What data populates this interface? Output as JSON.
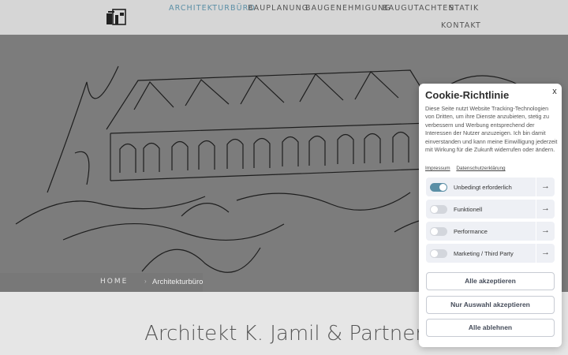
{
  "header": {
    "nav": [
      {
        "label": "ARCHITEKTURBÜRO",
        "active": true
      },
      {
        "label": "BAUPLANUNG",
        "active": false
      },
      {
        "label": "BAUGENEHMIGUNG",
        "active": false
      },
      {
        "label": "BAUGUTACHTEN",
        "active": false
      },
      {
        "label": "STATIK",
        "active": false
      },
      {
        "label": "KONTAKT",
        "active": false
      }
    ]
  },
  "breadcrumb": {
    "home": "HOME",
    "separator": "›",
    "current": "Architekturbüro"
  },
  "content": {
    "title": "Architekt K. Jamil & Partner"
  },
  "cookie": {
    "title": "Cookie-Richtlinie",
    "close": "x",
    "text": "Diese Seite nutzt Website Tracking-Technologien von Dritten, um ihre Dienste anzubieten, stetig zu verbessern und Werbung entsprechend der Interessen der Nutzer anzuzeigen. Ich bin damit einverstanden und kann meine Einwilligung jederzeit mit Wirkung für die Zukunft widerrufen oder ändern.",
    "links": {
      "impressum": "Impressum",
      "privacy": "Datenschutzerklärung"
    },
    "options": [
      {
        "label": "Unbedingt erforderlich",
        "enabled": true
      },
      {
        "label": "Funktionell",
        "enabled": false
      },
      {
        "label": "Performance",
        "enabled": false
      },
      {
        "label": "Marketing / Third Party",
        "enabled": false
      }
    ],
    "arrow": "→",
    "buttons": {
      "accept_all": "Alle akzeptieren",
      "accept_selection": "Nur Auswahl akzeptieren",
      "reject_all": "Alle ablehnen"
    }
  },
  "colors": {
    "accent": "#5b8fa6",
    "header_bg": "#d6d6d6",
    "hero_bg": "#777777"
  }
}
